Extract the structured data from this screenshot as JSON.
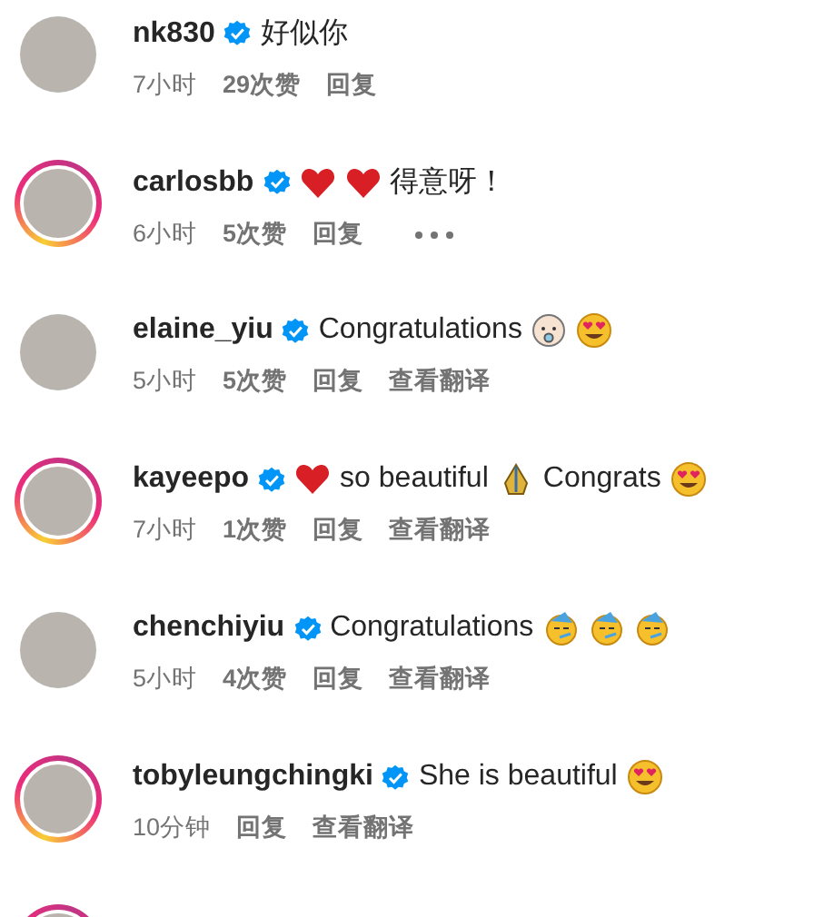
{
  "comments": [
    {
      "username": "nk830",
      "verified": true,
      "story": false,
      "parts": [
        {
          "kind": "text",
          "text": "好似你"
        }
      ],
      "time": "7小时",
      "likes": "29次赞",
      "reply": "回复"
    },
    {
      "username": "carlosbb",
      "verified": true,
      "story": true,
      "parts": [
        {
          "kind": "heart"
        },
        {
          "kind": "heart"
        },
        {
          "kind": "text",
          "text": "得意呀！"
        }
      ],
      "time": "6小时",
      "likes": "5次赞",
      "reply": "回复",
      "more": true
    },
    {
      "username": "elaine_yiu",
      "verified": true,
      "story": false,
      "parts": [
        {
          "kind": "text",
          "text": "Congratulations"
        },
        {
          "kind": "baby"
        },
        {
          "kind": "heart-eyes"
        }
      ],
      "time": "5小时",
      "likes": "5次赞",
      "reply": "回复",
      "translate": "查看翻译"
    },
    {
      "username": "kayeepo",
      "verified": true,
      "story": true,
      "parts": [
        {
          "kind": "heart"
        },
        {
          "kind": "text",
          "text": "so beautiful"
        },
        {
          "kind": "praying-hands"
        },
        {
          "kind": "text",
          "text": "Congrats"
        },
        {
          "kind": "heart-eyes"
        }
      ],
      "time": "7小时",
      "likes": "1次赞",
      "reply": "回复",
      "translate": "查看翻译"
    },
    {
      "username": "chenchiyiu",
      "verified": true,
      "story": false,
      "parts": [
        {
          "kind": "text",
          "text": "Congratulations"
        },
        {
          "kind": "party-face"
        },
        {
          "kind": "party-face"
        },
        {
          "kind": "party-face"
        }
      ],
      "time": "5小时",
      "likes": "4次赞",
      "reply": "回复",
      "translate": "查看翻译"
    },
    {
      "username": "tobyleungchingki",
      "verified": true,
      "story": true,
      "parts": [
        {
          "kind": "text",
          "text": "She is beautiful"
        },
        {
          "kind": "heart-eyes"
        }
      ],
      "time": "10分钟",
      "reply": "回复",
      "translate": "查看翻译"
    }
  ],
  "next_comment": {
    "story": true
  }
}
